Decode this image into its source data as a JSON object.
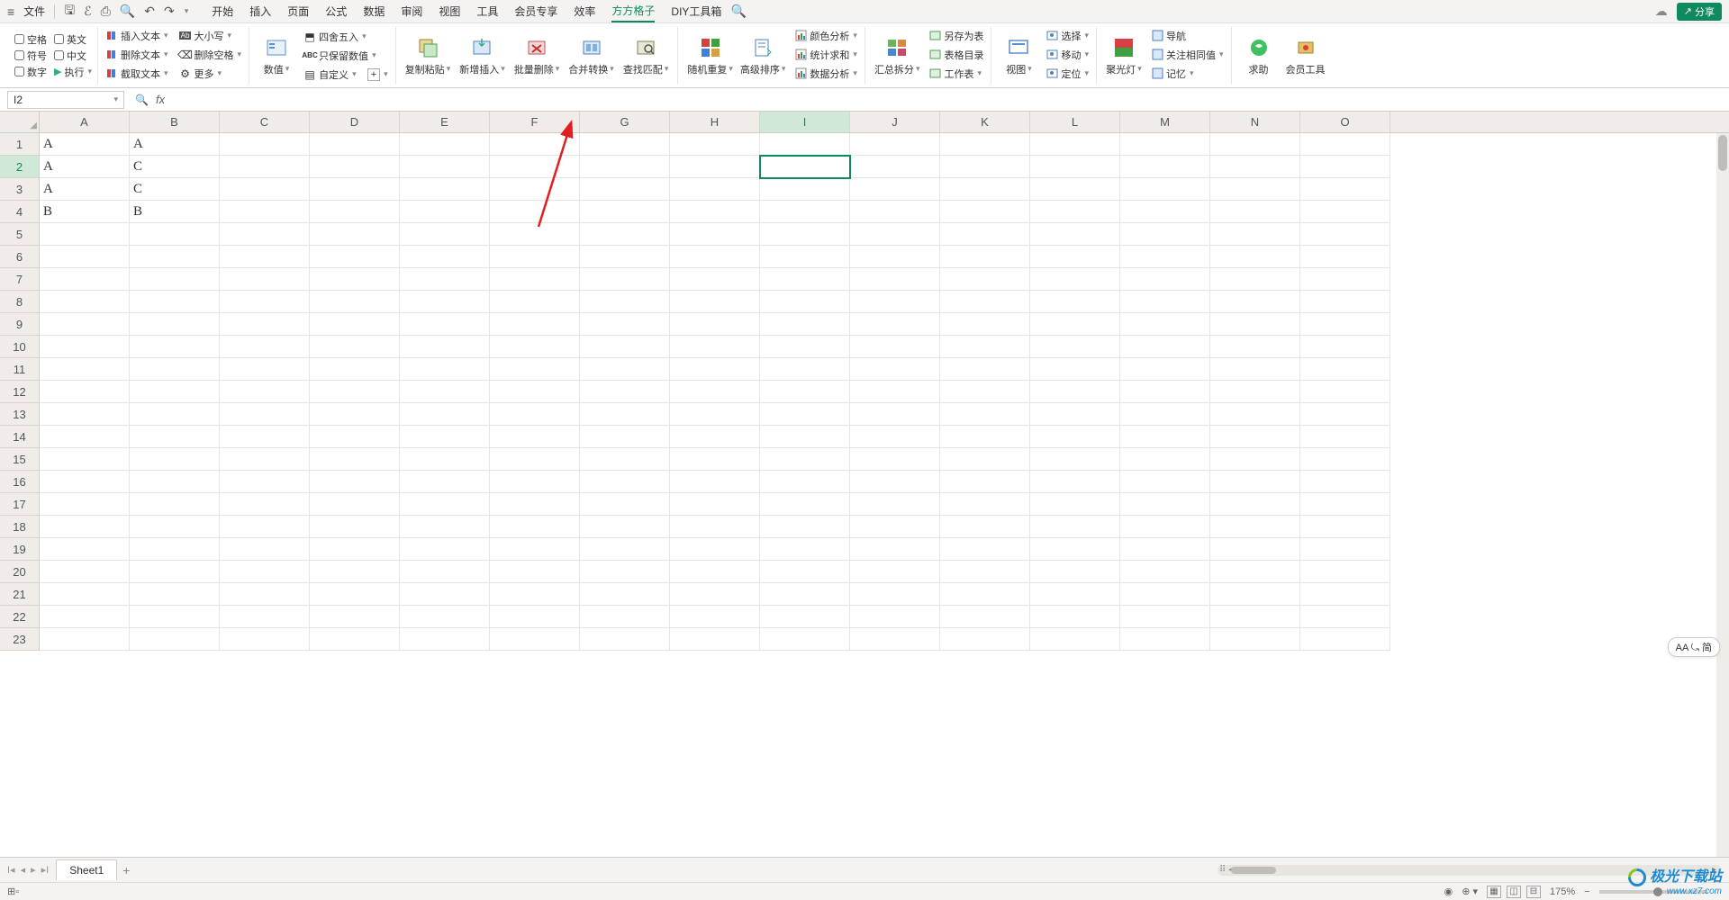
{
  "titlebar": {
    "file": "文件",
    "tabs": [
      "开始",
      "插入",
      "页面",
      "公式",
      "数据",
      "审阅",
      "视图",
      "工具",
      "会员专享",
      "效率",
      "方方格子",
      "DIY工具箱"
    ],
    "active_tab_index": 10,
    "share": "分享"
  },
  "ribbon": {
    "checks_col1": [
      "空格",
      "符号",
      "数字"
    ],
    "checks_col2": [
      "英文",
      "中文",
      "执行"
    ],
    "group2": [
      "插入文本",
      "删除文本",
      "截取文本"
    ],
    "group2b": [
      "大小写",
      "删除空格",
      "更多"
    ],
    "group3": {
      "big": "数值",
      "items": [
        "四舍五入",
        "只保留数值",
        "自定义"
      ],
      "plus": "+"
    },
    "group4_bigs": [
      "复制粘贴",
      "新增插入",
      "批量删除",
      "合并转换",
      "查找匹配"
    ],
    "group5_bigs": [
      "随机重复",
      "高级排序"
    ],
    "group5_items": [
      "颜色分析",
      "统计求和",
      "数据分析"
    ],
    "group6_big": "汇总拆分",
    "group6_items": [
      "另存为表",
      "表格目录",
      "工作表"
    ],
    "group7_big": "视图",
    "group7_items": [
      "选择",
      "移动",
      "定位"
    ],
    "group8_big": "聚光灯",
    "group8_items": [
      "导航",
      "关注相同值",
      "记忆"
    ],
    "group9_bigs": [
      "求助",
      "会员工具"
    ]
  },
  "formula_bar": {
    "name_box": "I2",
    "fx": "fx"
  },
  "columns": [
    "A",
    "B",
    "C",
    "D",
    "E",
    "F",
    "G",
    "H",
    "I",
    "J",
    "K",
    "L",
    "M",
    "N",
    "O"
  ],
  "active_col_index": 8,
  "row_count": 23,
  "active_row": 2,
  "data": {
    "1": {
      "A": "A",
      "B": "A"
    },
    "2": {
      "A": "A",
      "B": "C"
    },
    "3": {
      "A": "A",
      "B": "C"
    },
    "4": {
      "A": "B",
      "B": "B"
    }
  },
  "sheet": {
    "sheets": [
      "Sheet1"
    ]
  },
  "status": {
    "zoom": "175%"
  },
  "aa_pill": "AA ⤿ 简",
  "watermark": {
    "name": "极光下载站",
    "url": "www.xz7.com"
  }
}
